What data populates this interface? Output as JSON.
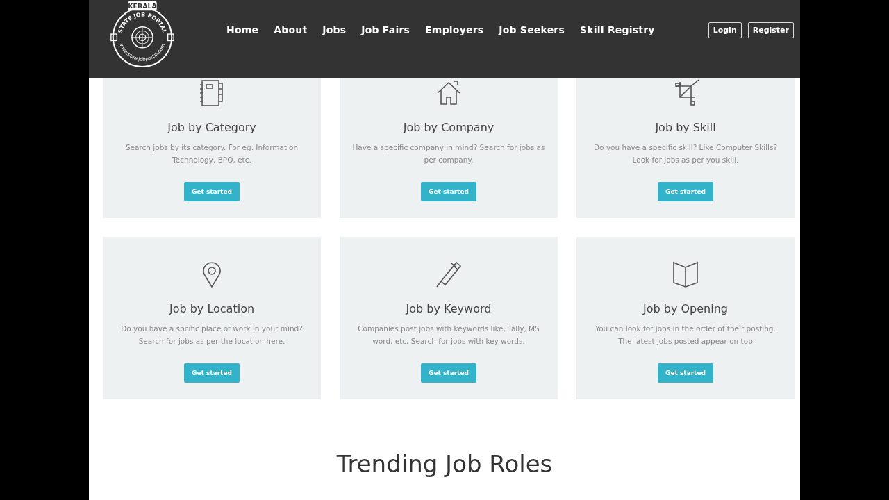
{
  "logo": {
    "top_text": "KERALA",
    "arc_text": "STATE JOB PORTAL",
    "url_text": "www.statejobportal.com"
  },
  "nav": [
    {
      "label": "Home"
    },
    {
      "label": "About"
    },
    {
      "label": "Jobs"
    },
    {
      "label": "Job Fairs"
    },
    {
      "label": "Employers"
    },
    {
      "label": "Job Seekers"
    },
    {
      "label": "Skill Registry"
    }
  ],
  "auth_buttons": [
    "Login",
    "Register"
  ],
  "cards": [
    {
      "kind": "notebook",
      "title": "Job by Category",
      "text": "Search jobs by its category. For eg. Information Technology, BPO, etc.",
      "button": "Get started"
    },
    {
      "kind": "house",
      "title": "Job by Company",
      "text": "Have a specific company in mind? Search for jobs as per company.",
      "button": "Get started"
    },
    {
      "kind": "crop",
      "title": "Job by Skill",
      "text": "Do you have a specific skill? Like Computer Skills? Look for jobs as per you skill.",
      "button": "Get started"
    },
    {
      "kind": "pin",
      "title": "Job by Location",
      "text": "Do you have a spcific place of work in your mind? Search for jobs as per the location here.",
      "button": "Get started"
    },
    {
      "kind": "pen",
      "title": "Job by Keyword",
      "text": "Companies post jobs with keywords like, Tally, MS word, etc. Search for jobs with key words.",
      "button": "Get started"
    },
    {
      "kind": "book",
      "title": "Job by Opening",
      "text": "You can look for jobs in the order of their posting. The latest jobs posted appear on top",
      "button": "Get started"
    }
  ],
  "section_title": "Trending Job Roles"
}
